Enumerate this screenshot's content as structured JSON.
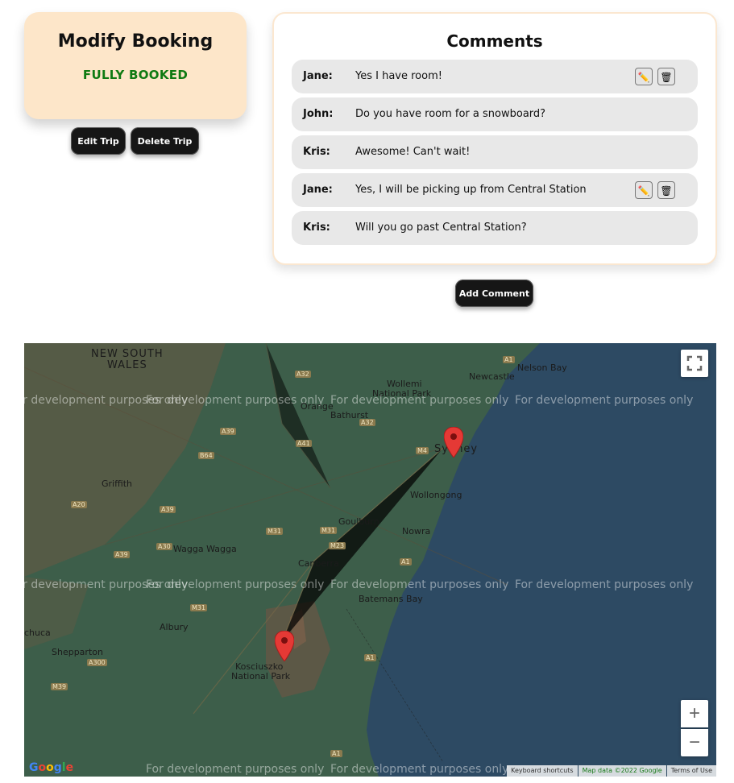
{
  "booking": {
    "title": "Modify Booking",
    "status": "FULLY BOOKED",
    "edit_label": "Edit Trip",
    "delete_label": "Delete Trip"
  },
  "comments": {
    "title": "Comments",
    "add_label": "Add Comment",
    "items": [
      {
        "author": "Jane:",
        "text": "Yes I have room!",
        "editable": true
      },
      {
        "author": "John:",
        "text": "Do you have room for a snowboard?",
        "editable": false
      },
      {
        "author": "Kris:",
        "text": "Awesome! Can't wait!",
        "editable": false
      },
      {
        "author": "Jane:",
        "text": "Yes, I will be picking up from Central Station",
        "editable": true
      },
      {
        "author": "Kris:",
        "text": "Will you go past Central Station?",
        "editable": false
      }
    ],
    "edit_icon": "pencil-icon",
    "delete_icon": "trash-icon"
  },
  "map": {
    "watermark": "For development purposes only",
    "labels": {
      "nsw1": "NEW SOUTH",
      "nsw2": "WALES",
      "newcastle": "Newcastle",
      "nelson_bay": "Nelson Bay",
      "wollemi1": "Wollemi",
      "wollemi2": "National Park",
      "orange": "Orange",
      "bathurst": "Bathurst",
      "sydney": "Sydney",
      "griffith": "Griffith",
      "wollongong": "Wollongong",
      "goulburn": "Goulburn",
      "nowra": "Nowra",
      "wagga": "Wagga Wagga",
      "canberra": "Canberra",
      "batemans": "Batemans Bay",
      "albury": "Albury",
      "echuca": "chuca",
      "shepparton": "Shepparton",
      "kosciuszko1": "Kosciuszko",
      "kosciuszko2": "National Park"
    },
    "road_badges": [
      "A1",
      "A32",
      "A32",
      "A39",
      "B64",
      "A41",
      "M4",
      "A20",
      "A39",
      "A30",
      "M31",
      "M31",
      "M23",
      "A1",
      "A39",
      "M31",
      "A300",
      "M39",
      "A1",
      "A1"
    ],
    "footer": {
      "keyboard": "Keyboard shortcuts",
      "map_data": "Map data ©2022 Google",
      "terms": "Terms of Use"
    },
    "logo": "Google",
    "zoom_in": "+",
    "zoom_out": "−",
    "colors": {
      "water": "#2d4a63",
      "land": "#3d5e4a",
      "marker": "#e53935"
    }
  }
}
